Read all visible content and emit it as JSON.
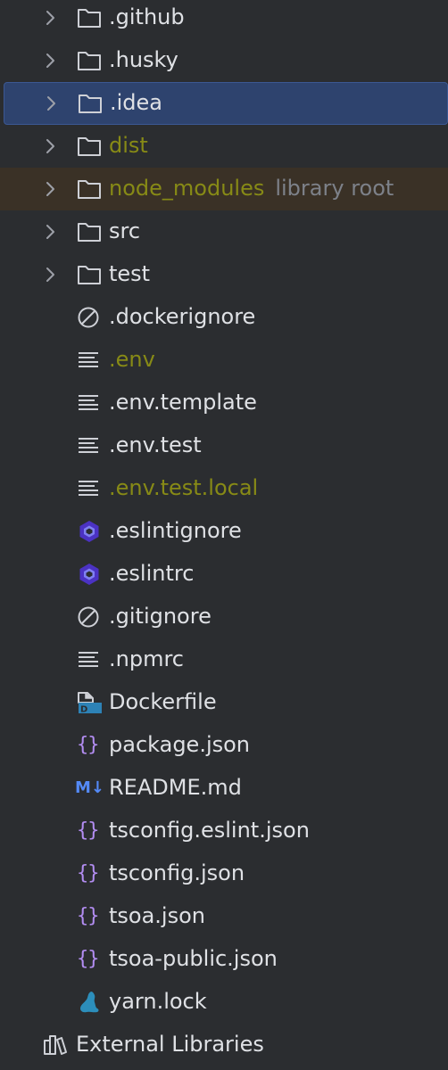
{
  "tree": {
    "items": [
      {
        "label": ".github",
        "kind": "folder"
      },
      {
        "label": ".husky",
        "kind": "folder"
      },
      {
        "label": ".idea",
        "kind": "folder",
        "selected": true
      },
      {
        "label": "dist",
        "kind": "folder",
        "color": "#878a16"
      },
      {
        "label": "node_modules",
        "hint": "library root",
        "kind": "folder",
        "color": "#878a16"
      },
      {
        "label": "src",
        "kind": "folder"
      },
      {
        "label": "test",
        "kind": "folder"
      },
      {
        "label": ".dockerignore",
        "kind": "ignore-file"
      },
      {
        "label": ".env",
        "kind": "text-file",
        "color": "#878a16"
      },
      {
        "label": ".env.template",
        "kind": "text-file"
      },
      {
        "label": ".env.test",
        "kind": "text-file"
      },
      {
        "label": ".env.test.local",
        "kind": "text-file",
        "color": "#878a16"
      },
      {
        "label": ".eslintignore",
        "kind": "eslint-file"
      },
      {
        "label": ".eslintrc",
        "kind": "eslint-file"
      },
      {
        "label": ".gitignore",
        "kind": "ignore-file"
      },
      {
        "label": ".npmrc",
        "kind": "text-file"
      },
      {
        "label": "Dockerfile",
        "kind": "docker-file"
      },
      {
        "label": "package.json",
        "kind": "json-file"
      },
      {
        "label": "README.md",
        "kind": "markdown-file"
      },
      {
        "label": "tsconfig.eslint.json",
        "kind": "json-file"
      },
      {
        "label": "tsconfig.json",
        "kind": "json-file"
      },
      {
        "label": "tsoa.json",
        "kind": "json-file"
      },
      {
        "label": "tsoa-public.json",
        "kind": "json-file"
      },
      {
        "label": "yarn.lock",
        "kind": "yarn-file"
      }
    ],
    "external_libraries": {
      "label": "External Libraries"
    }
  },
  "icon_glyphs": {
    "json": "{}",
    "markdown": "M↓"
  },
  "colors": {
    "background": "#2b2d30",
    "selection": "#2e436e",
    "library_root_bg": "#3a3126",
    "excluded_text": "#878a16",
    "text": "#dfe1e5",
    "hint_text": "#7d8189",
    "json_icon": "#b38df2",
    "eslint_icon": "#4b32c3",
    "docker_icon": "#2d82b6",
    "yarn_icon": "#2c8ebb"
  }
}
